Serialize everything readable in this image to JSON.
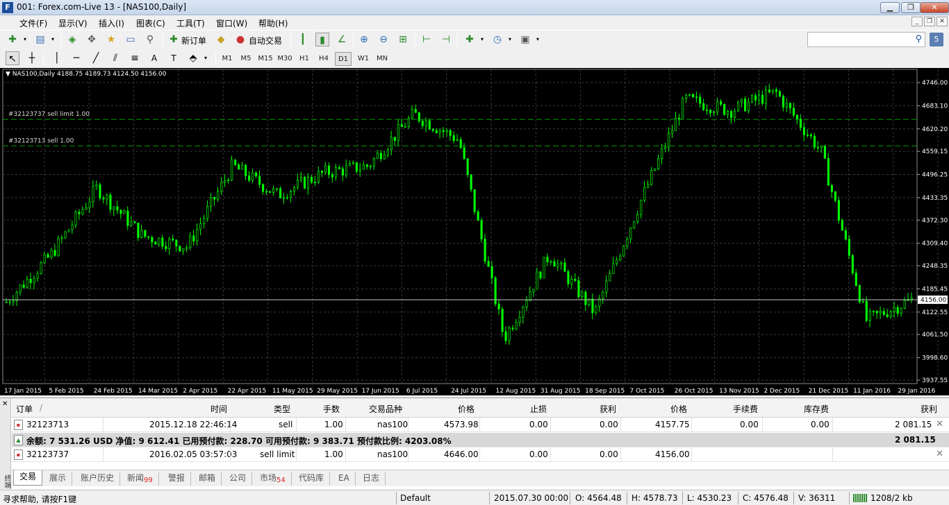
{
  "window": {
    "icon_letter": "F",
    "title": "        001: Forex.com-Live 13 - [NAS100,Daily]",
    "buttons": [
      "▁",
      "❐",
      "✕"
    ]
  },
  "menu": [
    "文件(F)",
    "显示(V)",
    "插入(I)",
    "图表(C)",
    "工具(T)",
    "窗口(W)",
    "帮助(H)"
  ],
  "toolbar": {
    "new_order_label": "新订单",
    "auto_trading_label": "自动交易",
    "search_placeholder": ""
  },
  "timeframes": [
    "M1",
    "M5",
    "M15",
    "M30",
    "H1",
    "H4",
    "D1",
    "W1",
    "MN"
  ],
  "active_timeframe": "D1",
  "chart": {
    "header": "▼ NAS100,Daily  4188.75 4189.73 4124.50 4156.00",
    "order_lines": [
      {
        "label": "#32123737 sell limit 1.00",
        "price": 4646.0
      },
      {
        "label": "#32123713 sell 1.00",
        "price": 4573.98
      }
    ],
    "current_price_label": "4156.00"
  },
  "chart_data": {
    "type": "candlestick",
    "symbol": "NAS100",
    "timeframe": "Daily",
    "ohlc_last": {
      "open": 4188.75,
      "high": 4189.73,
      "low": 4124.5,
      "close": 4156.0
    },
    "current_price": 4156.0,
    "ylim": [
      3937.55,
      4746.0
    ],
    "y_ticks": [
      "4746.00",
      "4683.10",
      "4620.20",
      "4559.15",
      "4496.25",
      "4433.35",
      "4372.30",
      "4309.40",
      "4248.35",
      "4185.45",
      "4122.55",
      "4061.50",
      "3998.60",
      "3937.55"
    ],
    "x_ticks": [
      "17 Jan 2015",
      "5 Feb 2015",
      "24 Feb 2015",
      "14 Mar 2015",
      "2 Apr 2015",
      "22 Apr 2015",
      "11 May 2015",
      "29 May 2015",
      "17 Jun 2015",
      "6 Jul 2015",
      "24 Jul 2015",
      "12 Aug 2015",
      "31 Aug 2015",
      "18 Sep 2015",
      "7 Oct 2015",
      "26 Oct 2015",
      "13 Nov 2015",
      "2 Dec 2015",
      "21 Dec 2015",
      "11 Jan 2016",
      "29 Jan 2016"
    ],
    "close_path": [
      [
        "17 Jan 2015",
        4150
      ],
      [
        "5 Feb 2015",
        4280
      ],
      [
        "24 Feb 2015",
        4460
      ],
      [
        "14 Mar 2015",
        4330
      ],
      [
        "2 Apr 2015",
        4300
      ],
      [
        "22 Apr 2015",
        4520
      ],
      [
        "11 May 2015",
        4440
      ],
      [
        "29 May 2015",
        4500
      ],
      [
        "17 Jun 2015",
        4520
      ],
      [
        "6 Jul 2015",
        4660
      ],
      [
        "24 Jul 2015",
        4590
      ],
      [
        "12 Aug 2015",
        4050
      ],
      [
        "31 Aug 2015",
        4280
      ],
      [
        "18 Sep 2015",
        4120
      ],
      [
        "7 Oct 2015",
        4420
      ],
      [
        "26 Oct 2015",
        4700
      ],
      [
        "13 Nov 2015",
        4670
      ],
      [
        "2 Dec 2015",
        4720
      ],
      [
        "21 Dec 2015",
        4560
      ],
      [
        "11 Jan 2016",
        4100
      ],
      [
        "29 Jan 2016",
        4156
      ]
    ]
  },
  "terminal": {
    "side_label": "终端",
    "headers": [
      "订单",
      "/",
      "时间",
      "类型",
      "手数",
      "交易品种",
      "价格",
      "止损",
      "获利",
      "价格",
      "手续费",
      "库存费",
      "获利"
    ],
    "rows": [
      {
        "order": "32123713",
        "time": "2015.12.18 22:46:14",
        "type": "sell",
        "lots": "1.00",
        "symbol": "nas100",
        "price": "4573.98",
        "sl": "0.00",
        "tp": "0.00",
        "cur_price": "4157.75",
        "commission": "0.00",
        "swap": "0.00",
        "profit": "2 081.15"
      },
      {
        "order": "32123737",
        "time": "2016.02.05 03:57:03",
        "type": "sell limit",
        "lots": "1.00",
        "symbol": "nas100",
        "price": "4646.00",
        "sl": "0.00",
        "tp": "0.00",
        "cur_price": "4156.00",
        "commission": "",
        "swap": "",
        "profit": ""
      }
    ],
    "summary": "余额: 7 531.26 USD  净值: 9 612.41  已用预付款: 228.70  可用预付款: 9 383.71  预付款比例: 4203.08%",
    "summary_profit": "2 081.15"
  },
  "tabs": [
    {
      "label": "交易",
      "badge": ""
    },
    {
      "label": "展示",
      "badge": ""
    },
    {
      "label": "账户历史",
      "badge": ""
    },
    {
      "label": "新闻",
      "badge": "99"
    },
    {
      "label": "警报",
      "badge": ""
    },
    {
      "label": "邮箱",
      "badge": ""
    },
    {
      "label": "公司",
      "badge": ""
    },
    {
      "label": "市场",
      "badge": "54"
    },
    {
      "label": "代码库",
      "badge": ""
    },
    {
      "label": "EA",
      "badge": ""
    },
    {
      "label": "日志",
      "badge": ""
    }
  ],
  "status": {
    "help": "寻求帮助, 请按F1键",
    "profile": "Default",
    "datetime": "2015.07.30 00:00",
    "open": "O: 4564.48",
    "high": "H: 4578.73",
    "low": "L: 4530.23",
    "close": "C: 4576.48",
    "volume": "V: 36311",
    "traffic": "1208/2 kb"
  },
  "colors": {
    "chart_bg": "#000000",
    "candle": "#00ff00",
    "grid": "#3a3a3a",
    "order_line": "#00a000",
    "axis_text": "#ffffff"
  }
}
